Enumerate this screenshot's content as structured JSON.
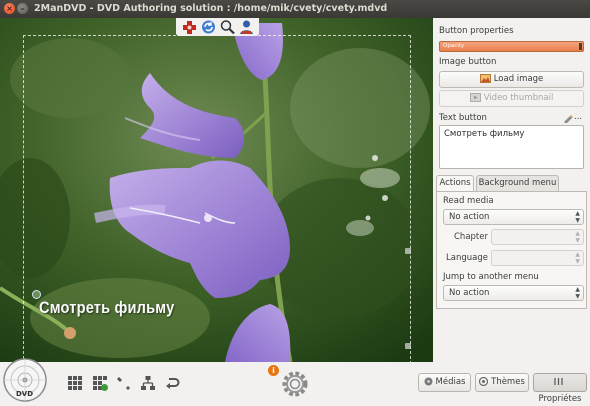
{
  "window": {
    "title": "2ManDVD - DVD Authoring solution : /home/mik/cvety/cvety.mdvd",
    "close_glyph": "×",
    "minimize_glyph": "–"
  },
  "preview": {
    "button_text": "Смотреть фильму",
    "top_toolbar_icons": [
      "add-red-icon",
      "refresh-icon",
      "zoom-icon",
      "disc-user-icon"
    ]
  },
  "properties": {
    "section_title": "Button properties",
    "opacity_label": "Opacity",
    "image_button_label": "Image button",
    "load_image_label": "Load image",
    "video_thumbnail_label": "Video thumbnail",
    "text_button_label": "Text button",
    "edit_text_glyph": "...",
    "text_value": "Смотреть фильму",
    "tabs": [
      {
        "label": "Actions",
        "active": true
      },
      {
        "label": "Background menu",
        "active": false
      }
    ],
    "read_media_label": "Read media",
    "read_media_value": "No action",
    "chapter_label": "Chapter",
    "chapter_value": "",
    "language_label": "Language",
    "language_value": "",
    "jump_label": "Jump to another menu",
    "jump_value": "No action"
  },
  "bottom": {
    "info_glyph": "i",
    "tools": [
      "grid-icon",
      "grid-add-icon",
      "wrench-icon",
      "hierarchy-icon",
      "return-icon"
    ],
    "buttons": [
      {
        "label": "Médias",
        "active": false
      },
      {
        "label": "Thèmes",
        "active": false
      },
      {
        "label": "Propriétes",
        "active": true
      }
    ],
    "dvd_label": "DVD"
  },
  "colors": {
    "accent_orange": "#e8804e",
    "panel_bg": "#f2f1f0",
    "titlebar_bg": "#3c3b37"
  }
}
